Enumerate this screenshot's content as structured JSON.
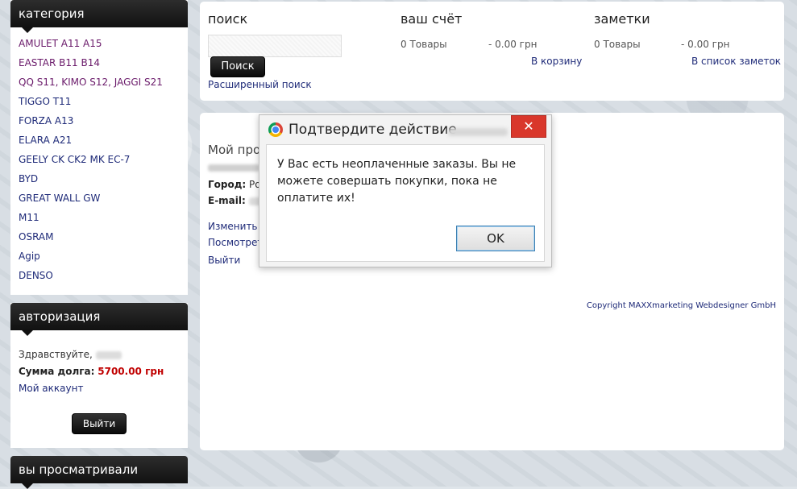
{
  "sidebar": {
    "category_title": "категория",
    "categories": [
      "AMULET A11 A15",
      "EASTAR B11 B14",
      "QQ S11, KIMO S12, JAGGI S21",
      "TIGGO T11",
      "FORZA A13",
      "ELARA A21",
      "GEELY CK CK2 MK EC-7",
      "BYD",
      "GREAT WALL GW",
      "M11",
      "OSRAM",
      "Agip",
      "DENSO"
    ],
    "auth_title": "авторизация",
    "greeting": "Здравствуйте,",
    "debt_label": "Сумма долга:",
    "debt_value": "5700.00 грн",
    "account_link": "Мой аккаунт",
    "logout_label": "Выйти",
    "viewed_title": "вы просматривали"
  },
  "top": {
    "search_title": "поиск",
    "search_button": "Поиск",
    "advanced_search": "Расширенный поиск",
    "account_title": "ваш счёт",
    "account_items": "0 Товары",
    "account_sum": "- 0.00 грн",
    "account_link": "В корзину",
    "notes_title": "заметки",
    "notes_items": "0 Товары",
    "notes_sum": "- 0.00 грн",
    "notes_link": "В список заметок"
  },
  "main": {
    "title": "Мой проф",
    "city_label": "Город:",
    "city_value": "Ро",
    "email_label": "E-mail:",
    "link_edit": "Изменить м",
    "link_view": "Посмотреть",
    "link_logout": "Выйти",
    "copyright": "Copyright MAXXmarketing Webdesigner GmbH"
  },
  "dialog": {
    "title": "Подтвердите действие",
    "message": "У Вас есть неоплаченные заказы. Вы не можете совершать покупки, пока не оплатите их!",
    "ok_label": "OK",
    "close_label": "✕"
  }
}
